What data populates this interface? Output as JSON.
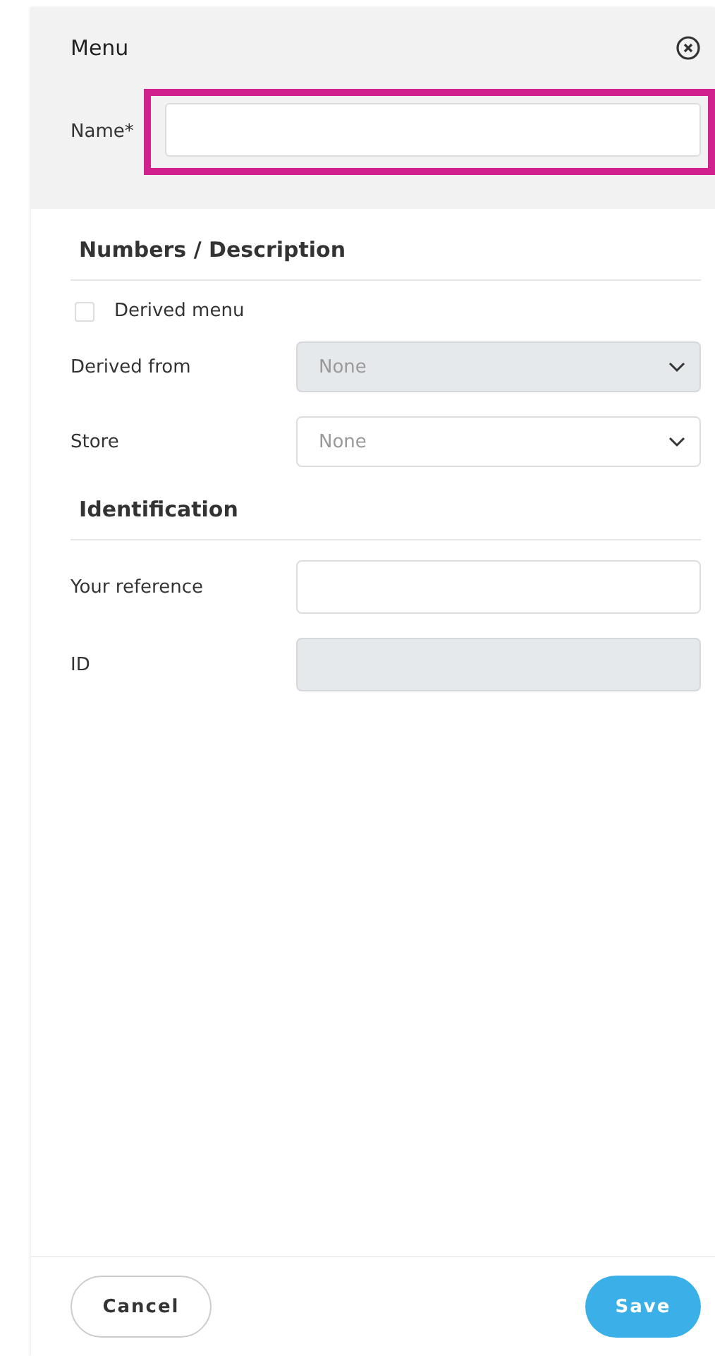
{
  "header": {
    "title": "Menu",
    "name_label": "Name*",
    "name_highlighted": true
  },
  "sections": [
    {
      "title": "Numbers / Description",
      "fields": [
        {
          "kind": "checkbox",
          "label": "Derived menu",
          "checked": false
        },
        {
          "kind": "select",
          "label": "Derived from",
          "value": "None",
          "disabled": true
        },
        {
          "kind": "select",
          "label": "Store",
          "value": "None",
          "disabled": false
        }
      ]
    },
    {
      "title": "Identification",
      "fields": [
        {
          "kind": "text",
          "label": "Your reference",
          "disabled": false
        },
        {
          "kind": "text",
          "label": "ID",
          "disabled": true
        }
      ]
    }
  ],
  "buttons": [
    {
      "label": "Cancel",
      "kind": "secondary"
    },
    {
      "label": "Save",
      "kind": "primary"
    }
  ]
}
